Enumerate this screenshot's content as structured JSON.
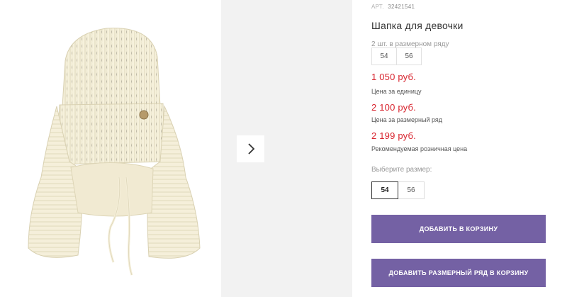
{
  "product": {
    "article_label": "АРТ.",
    "article_number": "32421541",
    "title": "Шапка для девочки",
    "image_alt": "knitted-hat"
  },
  "size_set": {
    "note": "2 шт. в размерном ряду",
    "sizes": [
      "54",
      "56"
    ]
  },
  "prices": [
    {
      "value": "1 050 руб.",
      "label": "Цена за единицу"
    },
    {
      "value": "2 100 руб.",
      "label": "Цена за размерный ряд"
    },
    {
      "value": "2 199 руб.",
      "label": "Рекомендуемая розничная цена"
    }
  ],
  "size_picker": {
    "label": "Выберите размер:",
    "options": [
      "54",
      "56"
    ],
    "selected": "54"
  },
  "buttons": {
    "add_to_cart": "Добавить в корзину",
    "add_set_to_cart": "Добавить размерный ряд в корзину"
  },
  "colors": {
    "accent": "#7461a4",
    "price": "#d8242e"
  },
  "icons": {
    "next": "chevron-right-icon"
  }
}
